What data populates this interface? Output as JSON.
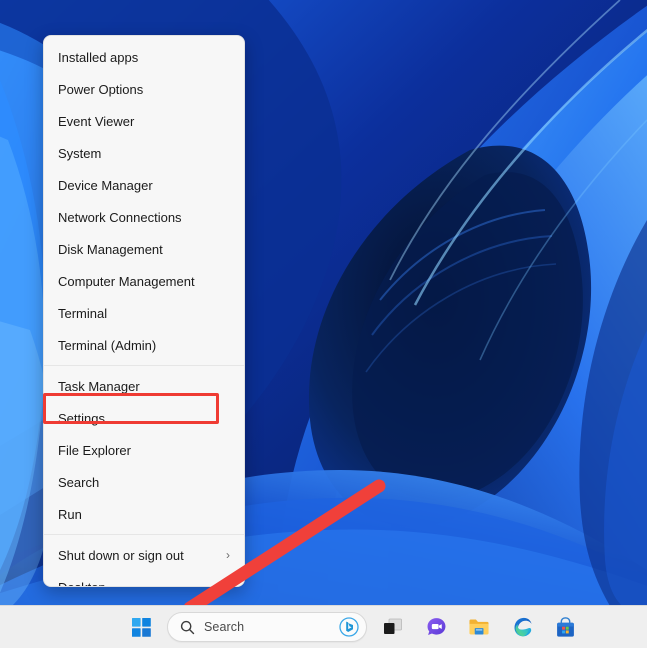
{
  "desktop": {
    "wallpaper_name": "windows-11-bloom-wallpaper",
    "colors": {
      "deep_blue": "#08246b",
      "mid_blue": "#1353d8",
      "bright_blue": "#2f86f7",
      "light_blue": "#4aa8ff",
      "dark_navy": "#061a4d"
    }
  },
  "winx_menu": {
    "name": "Win+X quick link menu",
    "items": [
      {
        "label": "Installed apps",
        "has_submenu": false,
        "separator_after": false
      },
      {
        "label": "Power Options",
        "has_submenu": false,
        "separator_after": false
      },
      {
        "label": "Event Viewer",
        "has_submenu": false,
        "separator_after": false
      },
      {
        "label": "System",
        "has_submenu": false,
        "separator_after": false
      },
      {
        "label": "Device Manager",
        "has_submenu": false,
        "separator_after": false
      },
      {
        "label": "Network Connections",
        "has_submenu": false,
        "separator_after": false
      },
      {
        "label": "Disk Management",
        "has_submenu": false,
        "separator_after": false
      },
      {
        "label": "Computer Management",
        "has_submenu": false,
        "separator_after": false
      },
      {
        "label": "Terminal",
        "has_submenu": false,
        "separator_after": false
      },
      {
        "label": "Terminal (Admin)",
        "has_submenu": false,
        "separator_after": true
      },
      {
        "label": "Task Manager",
        "has_submenu": false,
        "separator_after": false
      },
      {
        "label": "Settings",
        "has_submenu": false,
        "separator_after": false,
        "highlighted": true
      },
      {
        "label": "File Explorer",
        "has_submenu": false,
        "separator_after": false
      },
      {
        "label": "Search",
        "has_submenu": false,
        "separator_after": false
      },
      {
        "label": "Run",
        "has_submenu": false,
        "separator_after": true
      },
      {
        "label": "Shut down or sign out",
        "has_submenu": true,
        "submenu_glyph": "›",
        "separator_after": false
      },
      {
        "label": "Desktop",
        "has_submenu": false,
        "separator_after": false
      }
    ]
  },
  "annotations": {
    "highlight_color": "#ef3b33",
    "arrow_color": "#f0403a",
    "highlight_target": "Settings",
    "arrow_target": "Start button"
  },
  "taskbar": {
    "background": "#efefef",
    "search": {
      "placeholder": "Search",
      "value": "",
      "icon": "search-icon",
      "trailing_icon": "bing-copilot-icon"
    },
    "buttons": [
      {
        "name": "start-button",
        "label": "Start",
        "icon": "windows-logo-icon"
      },
      {
        "name": "task-view-button",
        "label": "Task view",
        "icon": "task-view-icon"
      },
      {
        "name": "chat-button",
        "label": "Chat",
        "icon": "chat-icon"
      },
      {
        "name": "file-explorer-button",
        "label": "File Explorer",
        "icon": "folder-icon"
      },
      {
        "name": "edge-button",
        "label": "Microsoft Edge",
        "icon": "edge-icon"
      },
      {
        "name": "store-button",
        "label": "Microsoft Store",
        "icon": "store-icon"
      }
    ]
  }
}
